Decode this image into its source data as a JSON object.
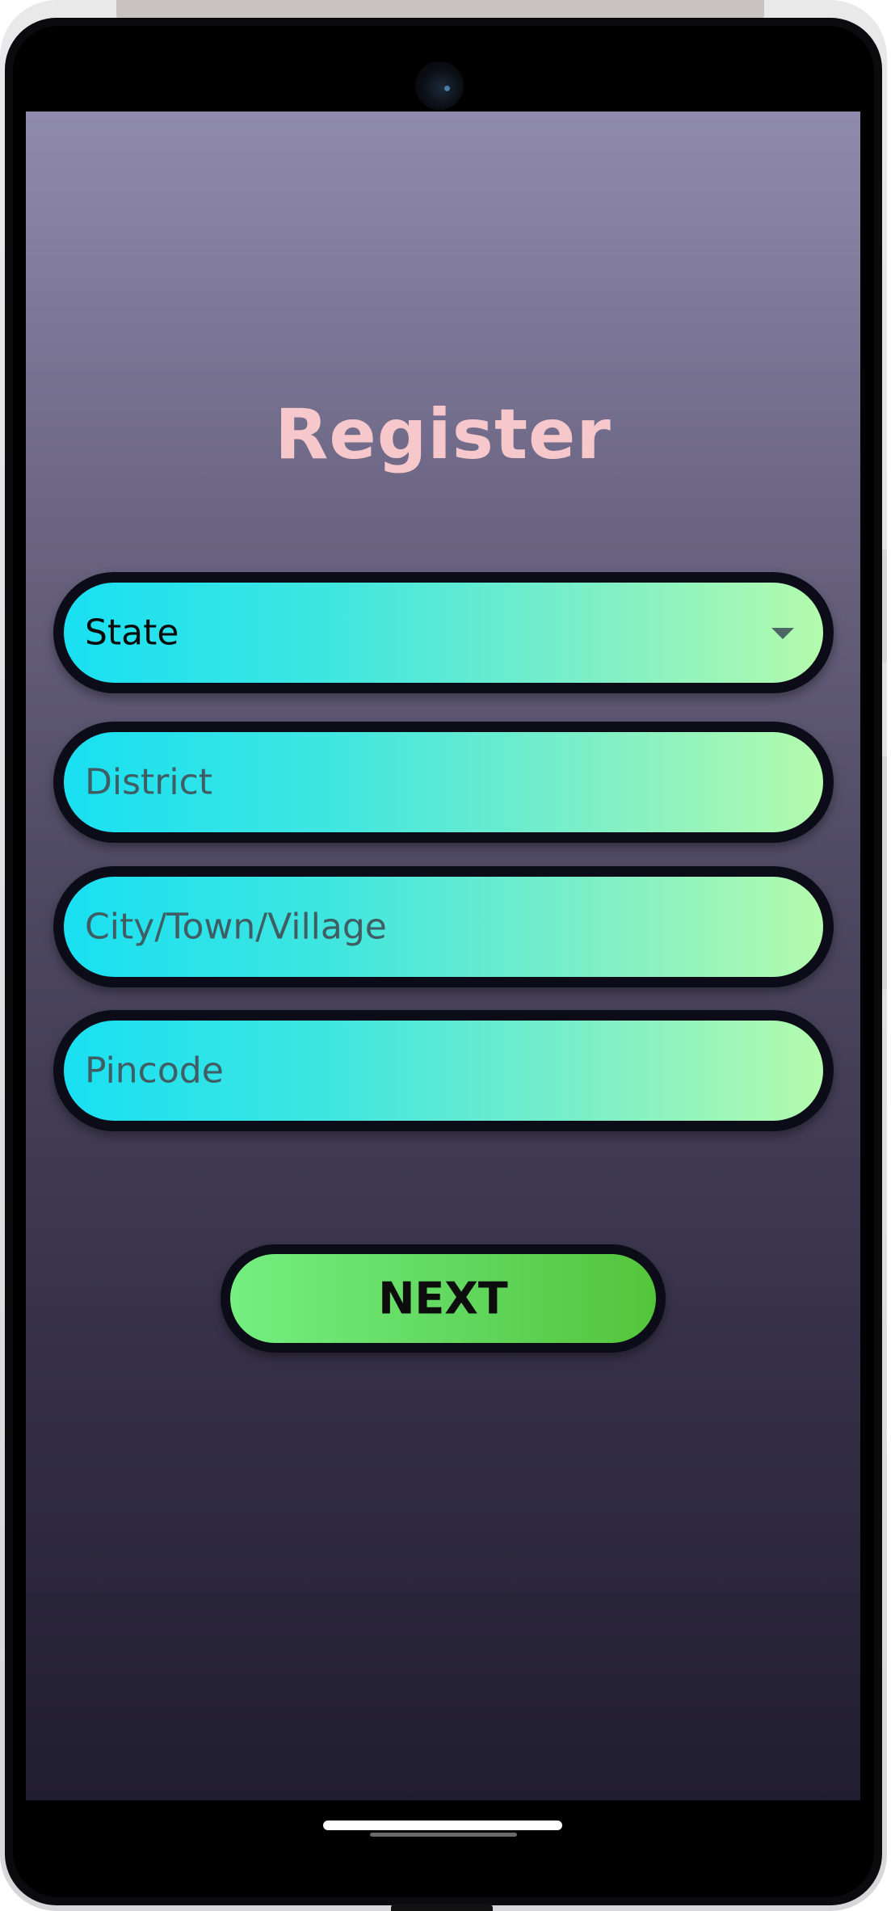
{
  "screen": {
    "title": "Register",
    "fields": [
      {
        "name": "state",
        "type": "dropdown",
        "value": "State"
      },
      {
        "name": "district",
        "type": "text",
        "placeholder": "District"
      },
      {
        "name": "city",
        "type": "text",
        "placeholder": "City/Town/Village"
      },
      {
        "name": "pincode",
        "type": "text",
        "placeholder": "Pincode"
      }
    ],
    "next_button": {
      "label": "NEXT"
    }
  },
  "colors": {
    "title": "#f6c8cc",
    "field_gradient_start": "#19e0f2",
    "field_gradient_end": "#b4fbad",
    "button_gradient_start": "#74ef80",
    "button_gradient_end": "#54c53a",
    "field_border": "#0c0b18",
    "background_top": "#908bad",
    "background_bottom": "#211d30"
  },
  "icons": {
    "dropdown": "caret-down-icon",
    "camera": "front-camera"
  }
}
